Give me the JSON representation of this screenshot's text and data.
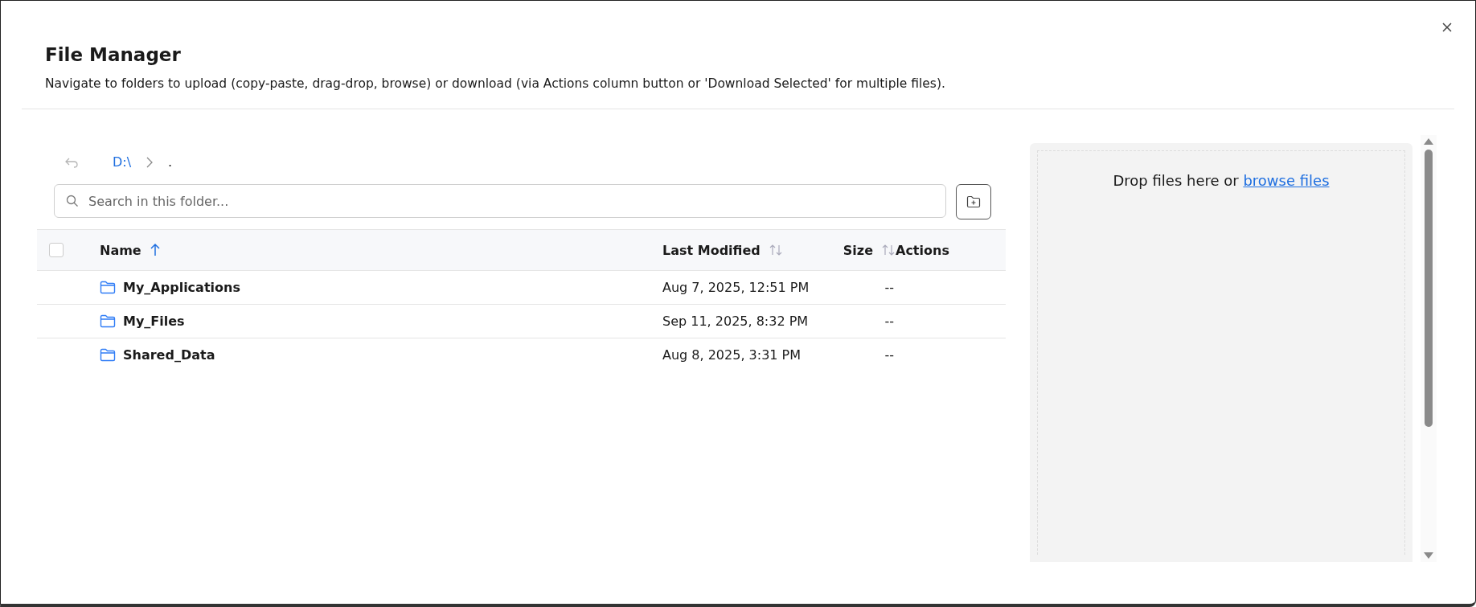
{
  "dialog": {
    "title": "File Manager",
    "description": "Navigate to folders to upload (copy-paste, drag-drop, browse) or download (via Actions column button or 'Download Selected' for multiple files)."
  },
  "breadcrumb": {
    "back_disabled": true,
    "items": [
      {
        "label": "D:\\",
        "selected": false
      },
      {
        "label": ".",
        "selected": true
      }
    ]
  },
  "search": {
    "placeholder": "Search in this folder..."
  },
  "table": {
    "select_all_checked": false,
    "columns": [
      {
        "label": "Name",
        "sorted": true
      },
      {
        "label": "Last Modified",
        "sorted": false
      },
      {
        "label": "Size",
        "sorted": false
      },
      {
        "label": "Actions"
      }
    ],
    "rows": [
      {
        "kind": "folder",
        "name": "My_Applications",
        "modified": "Aug 7, 2025, 12:51 PM",
        "size": "--"
      },
      {
        "kind": "folder",
        "name": "My_Files",
        "modified": "Sep 11, 2025, 8:32 PM",
        "size": "--"
      },
      {
        "kind": "folder",
        "name": "Shared_Data",
        "modified": "Aug 8, 2025, 3:31 PM",
        "size": "--"
      }
    ]
  },
  "dropzone": {
    "text": "Drop files here or",
    "link": "browse files"
  }
}
